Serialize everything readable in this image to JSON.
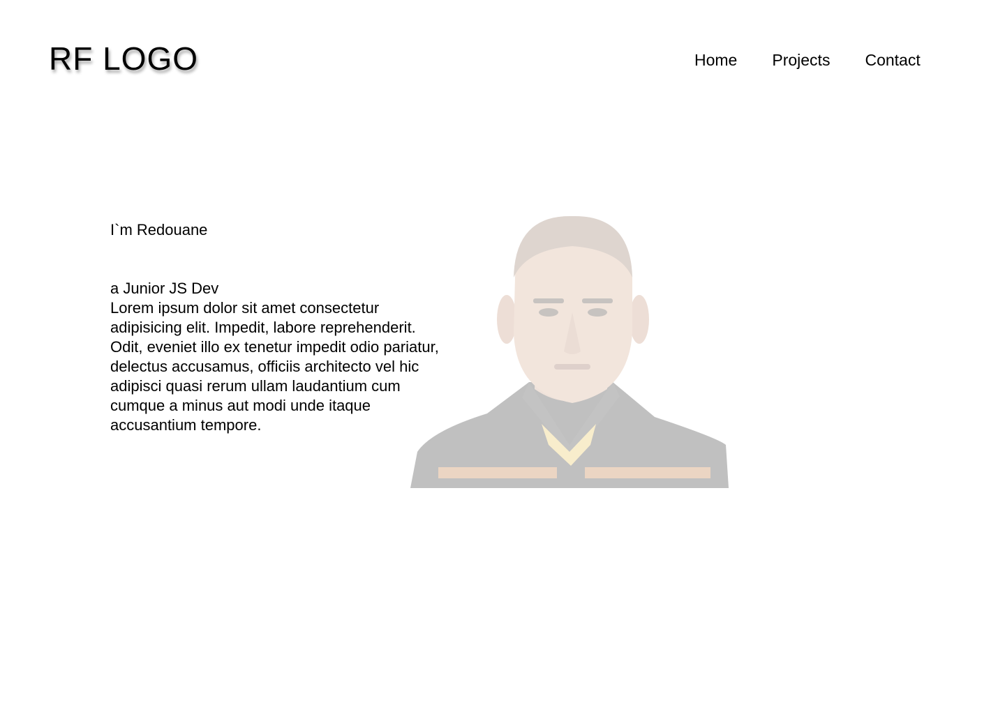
{
  "header": {
    "logo": "RF LOGO",
    "nav": [
      "Home",
      "Projects",
      "Contact"
    ]
  },
  "hero": {
    "greeting": "I`m Redouane",
    "role": "a Junior JS Dev",
    "bio": "Lorem ipsum dolor sit amet consectetur\nadipisicing elit. Impedit, labore reprehenderit.\nOdit, eveniet illo ex tenetur impedit odio pariatur,\n delectus accusamus, officiis architecto vel hic\nadipisci quasi rerum ullam laudantium cum\ncumque a minus aut modi unde itaque\n accusantium tempore.",
    "portrait_icon": "portrait-photo"
  },
  "colors": {
    "text": "#000000",
    "background": "#ffffff",
    "shirt": "#1f1f1f",
    "skin": "#c99a7e",
    "stripe": "#b86a2a"
  }
}
